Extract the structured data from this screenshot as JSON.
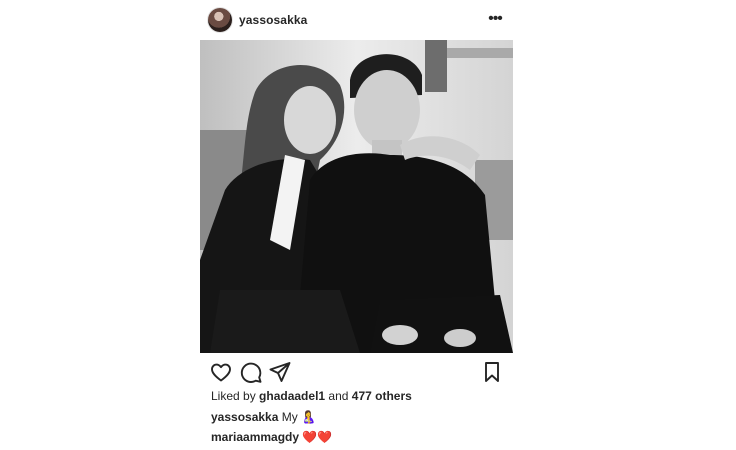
{
  "post": {
    "username": "yassosakka",
    "more_label": "•••",
    "photo_alt": "",
    "likes": {
      "prefix": "Liked by",
      "user": "ghadaadel1",
      "middle": "and",
      "others": "477 others"
    },
    "caption": {
      "username": "yassosakka",
      "text": "My",
      "emoji": "🤱"
    },
    "comment": {
      "username": "mariaammagdy",
      "hearts": "❤️❤️"
    }
  },
  "icons": {
    "like": "heart-outline-icon",
    "comment": "speech-bubble-icon",
    "share": "paper-plane-icon",
    "save": "bookmark-icon"
  },
  "colors": {
    "text": "#262626",
    "heart": "#e0263a"
  }
}
